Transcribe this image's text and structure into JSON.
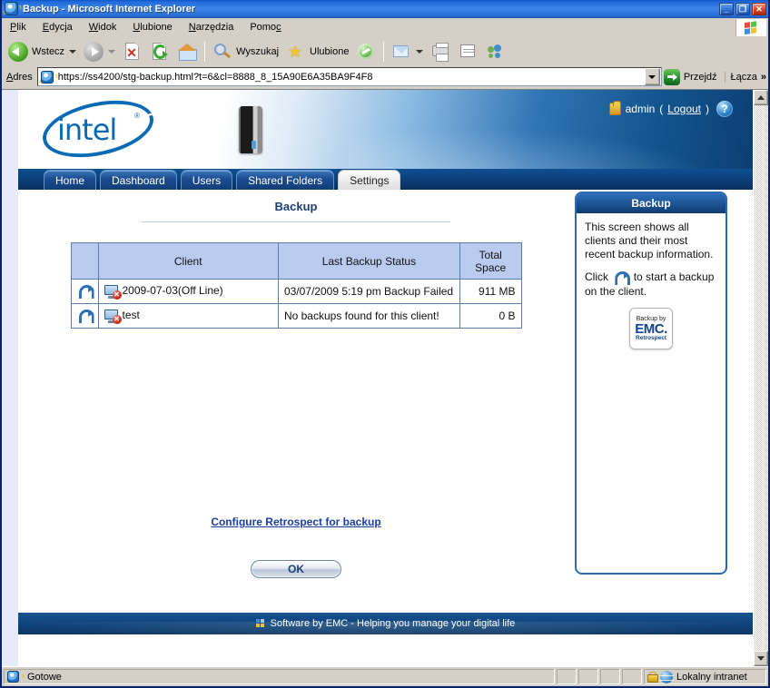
{
  "window": {
    "title": "Backup - Microsoft Internet Explorer",
    "icon": "ie-icon",
    "minimize_label": "_",
    "maximize_label": "❐",
    "close_label": "✕"
  },
  "menu": {
    "items": [
      {
        "label": "Plik",
        "accel": "P"
      },
      {
        "label": "Edycja",
        "accel": "E"
      },
      {
        "label": "Widok",
        "accel": "W"
      },
      {
        "label": "Ulubione",
        "accel": "U"
      },
      {
        "label": "Narzędzia",
        "accel": "N"
      },
      {
        "label": "Pomoc",
        "accel": "c"
      }
    ]
  },
  "toolbar": {
    "back_label": "Wstecz",
    "forward_label": "",
    "stop_label": "",
    "refresh_label": "",
    "home_label": "",
    "search_label": "Wyszukaj",
    "favorites_label": "Ulubione",
    "media_label": "",
    "mail_label": "",
    "print_label": "",
    "edit_label": "",
    "messenger_label": ""
  },
  "address": {
    "label": "Adres",
    "url": "https://ss4200/stg-backup.html?t=6&cl=8888_8_15A90E6A35BA9F4F8",
    "go_label": "Przejdź",
    "links_label": "Łącza",
    "chevron": "»"
  },
  "site": {
    "brand": "intel",
    "brand_reg": "®",
    "device_name": "ss4200",
    "user_name": "admin",
    "logout_label": "Logout",
    "logout_open": "(",
    "logout_close": ")",
    "help_glyph": "?"
  },
  "tabs": [
    {
      "label": "Home",
      "active": false
    },
    {
      "label": "Dashboard",
      "active": false
    },
    {
      "label": "Users",
      "active": false
    },
    {
      "label": "Shared Folders",
      "active": false
    },
    {
      "label": "Settings",
      "active": true
    }
  ],
  "main": {
    "page_title": "Backup",
    "table": {
      "headers": [
        "",
        "Client",
        "Last Backup Status",
        "Total Space"
      ],
      "rows": [
        {
          "action": "start-backup",
          "client": "2009-07-03(Off Line)",
          "status": "03/07/2009 5:19 pm Backup Failed",
          "space": "911 MB"
        },
        {
          "action": "start-backup",
          "client": "test",
          "status": "No backups found for this client!",
          "space": "0 B"
        }
      ]
    },
    "configure_link": "Configure Retrospect for backup",
    "ok_label": "OK"
  },
  "help_panel": {
    "title": "Backup",
    "paragraph1": "This screen shows all clients and their most recent backup information.",
    "click_prefix": "Click",
    "click_suffix": "to start a backup on the client.",
    "badge_line1": "Backup by",
    "badge_line2": "EMC",
    "badge_line2_dot": ".",
    "badge_line3": "Retrospect"
  },
  "footer": {
    "text": "Software by EMC - Helping you manage your digital life"
  },
  "statusbar": {
    "status": "Gotowe",
    "zone": "Lokalny intranet"
  },
  "colors": {
    "title_bar": "#1f68d8",
    "site_blue": "#13558f",
    "tab_active_bg": "#e9e9e9",
    "table_header": "#b9ccf0",
    "link_blue": "#1a3fa0",
    "accent": "#2a6ab5"
  }
}
